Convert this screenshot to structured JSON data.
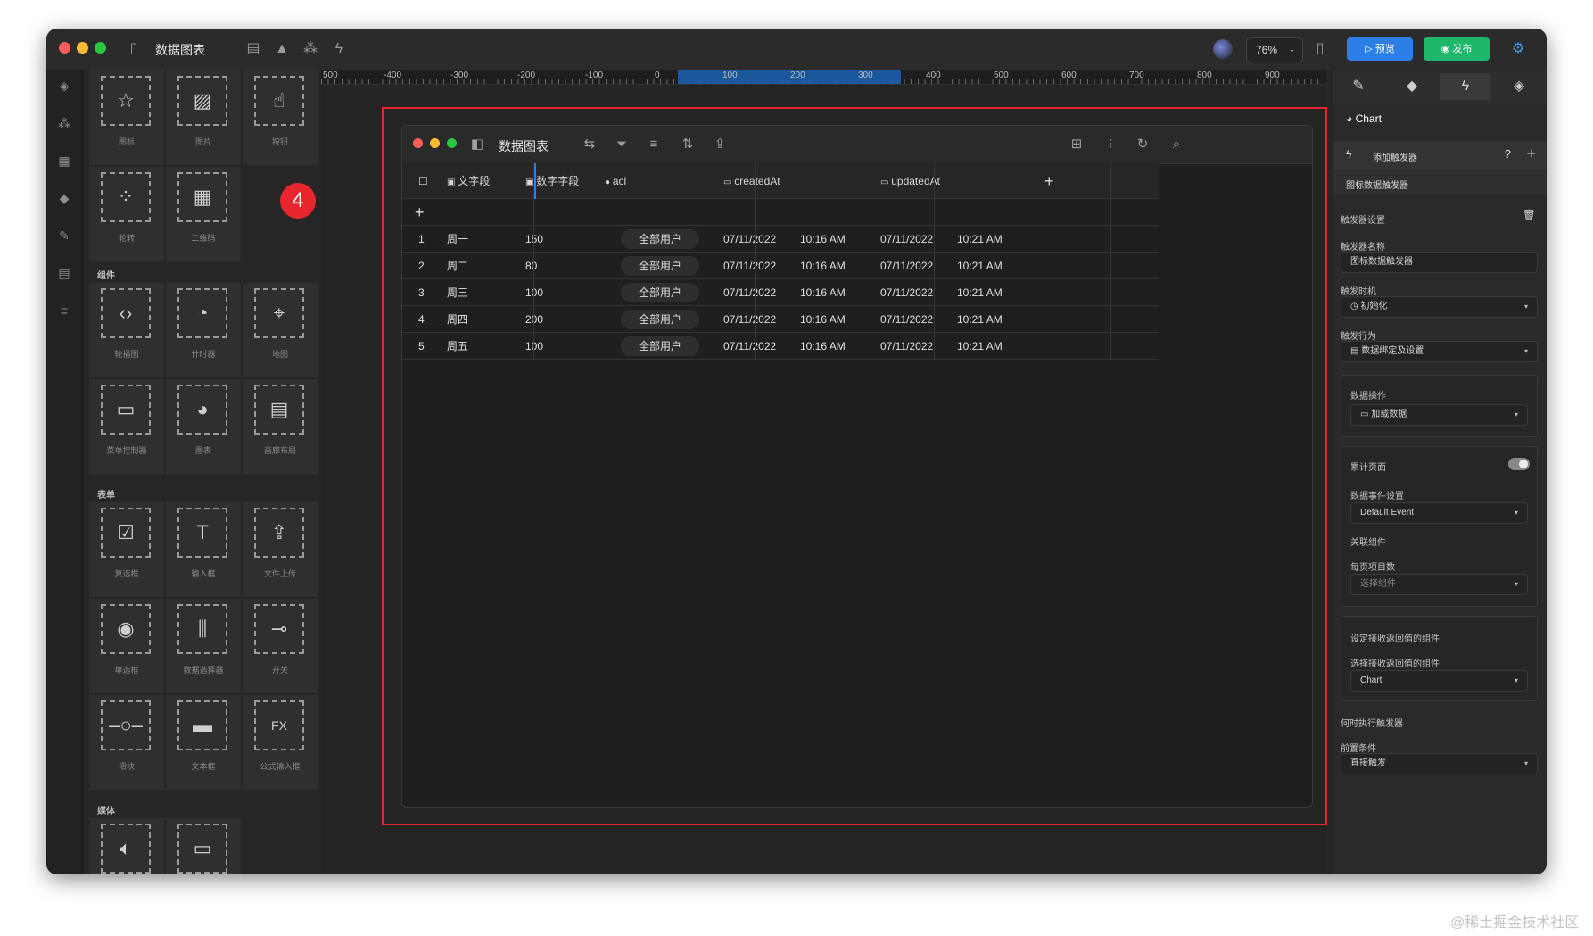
{
  "app": {
    "title": "数据图表",
    "zoom": "76%",
    "preview_label": "预览",
    "publish_label": "发布"
  },
  "palette": {
    "top_tiles": [
      "图标",
      "图片",
      "按钮",
      "轮转",
      "二维码"
    ],
    "sections": [
      {
        "label": "组件",
        "tiles": [
          "轮播图",
          "计时器",
          "地图",
          "菜单控制器",
          "图表",
          "画廊布局"
        ]
      },
      {
        "label": "表单",
        "tiles": [
          "复选框",
          "输入框",
          "文件上传",
          "单选框",
          "数据选择器",
          "开关",
          "滑块",
          "文本框",
          "公式输入框"
        ]
      },
      {
        "label": "媒体",
        "tiles": [
          "",
          ""
        ]
      }
    ],
    "tile_icons": {
      "图标": "star-icon",
      "图片": "image-icon",
      "按钮": "button-pointer-icon",
      "轮转": "dots-icon",
      "二维码": "qrcode-icon",
      "轮播图": "carousel-icon",
      "计时器": "timer-icon",
      "地图": "map-pin-icon",
      "菜单控制器": "menu-controller-icon",
      "图表": "pie-chart-icon",
      "画廊布局": "gallery-icon",
      "复选框": "checkbox-icon",
      "输入框": "input-icon",
      "文件上传": "upload-icon",
      "单选框": "radio-icon",
      "数据选择器": "data-picker-icon",
      "开关": "switch-icon",
      "滑块": "slider-icon",
      "文本框": "textbox-icon",
      "公式输入框": "formula-icon"
    }
  },
  "annotation_badge": "4",
  "ruler": {
    "labels": [
      "500",
      "-400",
      "-300",
      "-200",
      "-100",
      "0",
      "100",
      "200",
      "300",
      "400",
      "500",
      "600",
      "700",
      "800",
      "900"
    ]
  },
  "inner": {
    "title": "数据图表",
    "columns": [
      "文字段",
      "数字字段",
      "acl",
      "createdAt",
      "updatedAt"
    ],
    "rows": [
      {
        "n": "1",
        "text": "周一",
        "num": "150",
        "acl": "全部用户",
        "c_date": "07/11/2022",
        "c_time": "10:16 AM",
        "u_date": "07/11/2022",
        "u_time": "10:21 AM"
      },
      {
        "n": "2",
        "text": "周二",
        "num": "80",
        "acl": "全部用户",
        "c_date": "07/11/2022",
        "c_time": "10:16 AM",
        "u_date": "07/11/2022",
        "u_time": "10:21 AM"
      },
      {
        "n": "3",
        "text": "周三",
        "num": "100",
        "acl": "全部用户",
        "c_date": "07/11/2022",
        "c_time": "10:16 AM",
        "u_date": "07/11/2022",
        "u_time": "10:21 AM"
      },
      {
        "n": "4",
        "text": "周四",
        "num": "200",
        "acl": "全部用户",
        "c_date": "07/11/2022",
        "c_time": "10:16 AM",
        "u_date": "07/11/2022",
        "u_time": "10:21 AM"
      },
      {
        "n": "5",
        "text": "周五",
        "num": "100",
        "acl": "全部用户",
        "c_date": "07/11/2022",
        "c_time": "10:16 AM",
        "u_date": "07/11/2022",
        "u_time": "10:21 AM"
      }
    ]
  },
  "right": {
    "component_name": "Chart",
    "add_trigger": "添加触发器",
    "trigger_item": "图标数据触发器",
    "trigger_settings": "触发器设置",
    "trigger_name_label": "触发器名称",
    "trigger_name_value": "图标数据触发器",
    "trigger_time_label": "触发时机",
    "trigger_time_value": "初始化",
    "trigger_action_label": "触发行为",
    "trigger_action_value": "数据绑定及设置",
    "data_op_label": "数据操作",
    "data_op_value": "加载数据",
    "accumulate_label": "累计页面",
    "event_label": "数据事件设置",
    "event_value": "Default Event",
    "related_label": "关联组件",
    "per_page_label": "每页项目数",
    "per_page_placeholder": "选择组件",
    "receive_label": "设定接收返回值的组件",
    "receive_select_label": "选择接收返回值的组件",
    "receive_value": "Chart",
    "when_label": "何时执行触发器",
    "precondition_label": "前置条件",
    "precondition_value": "直接触发"
  },
  "colors": {
    "accent_blue": "#2a7ee6",
    "publish_green": "#1fb76a",
    "highlight_red": "#e3262f"
  },
  "watermark": "@稀土掘金技术社区"
}
